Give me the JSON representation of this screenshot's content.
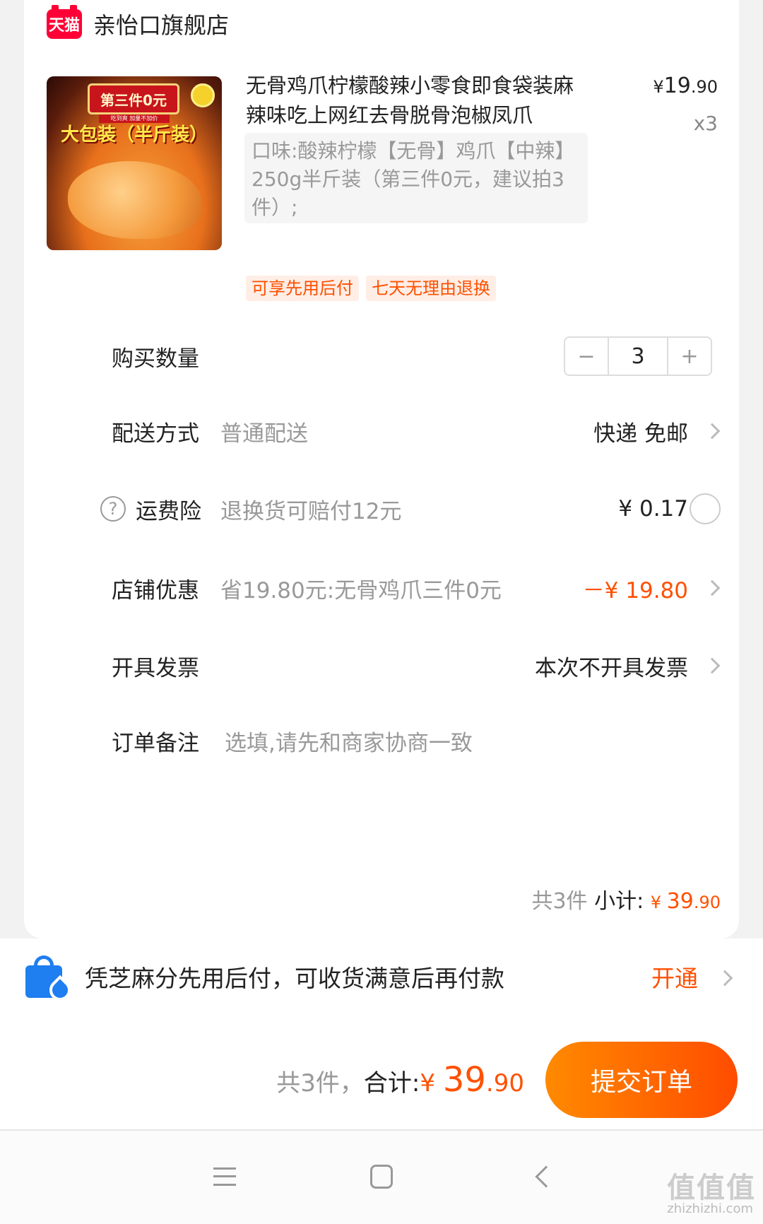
{
  "store": {
    "badge": "天猫",
    "name": "亲怡口旗舰店"
  },
  "product": {
    "image_promo": "第三件0元",
    "image_promo_sub": "吃到爽 加量不加价",
    "image_text": "大包装（半斤装）",
    "title": "无骨鸡爪柠檬酸辣小零食即食袋装麻辣味吃上网红去骨脱骨泡椒凤爪",
    "price_symbol": "¥",
    "price_int": "19",
    "price_dec": ".90",
    "quantity": "x3",
    "sku": "口味:酸辣柠檬【无骨】鸡爪【中辣】250g半斤装（第三件0元，建议拍3件）;",
    "tags": [
      "可享先用后付",
      "七天无理由退换"
    ]
  },
  "quantity_row": {
    "label": "购买数量",
    "minus": "−",
    "value": "3",
    "plus": "+"
  },
  "delivery": {
    "label": "配送方式",
    "desc": "普通配送",
    "value": "快递 免邮"
  },
  "insurance": {
    "icon": "?",
    "label": "运费险",
    "desc": "退换货可赔付12元",
    "value": "¥ 0.17"
  },
  "discount": {
    "label": "店铺优惠",
    "desc": "省19.80元:无骨鸡爪三件0元",
    "value": "－¥ 19.80"
  },
  "invoice": {
    "label": "开具发票",
    "value": "本次不开具发票"
  },
  "note": {
    "label": "订单备注",
    "placeholder": "选填,请先和商家协商一致"
  },
  "subtotal": {
    "count": "共3件",
    "label": " 小计: ",
    "symbol": "¥ ",
    "int": "39",
    "dec": ".90"
  },
  "zhima": {
    "text": "凭芝麻分先用后付，可收货满意后再付款",
    "action": "开通"
  },
  "footer": {
    "count": "共3件，",
    "label": "合计:",
    "symbol": "¥ ",
    "int": "39",
    "dec": ".90",
    "submit": "提交订单"
  },
  "watermark": {
    "text": "值值值",
    "sub": "zhizhizhi.com"
  },
  "colors": {
    "accent": "#ff5000",
    "tmall": "#ff0036",
    "zhima_blue": "#1f7ef0"
  }
}
